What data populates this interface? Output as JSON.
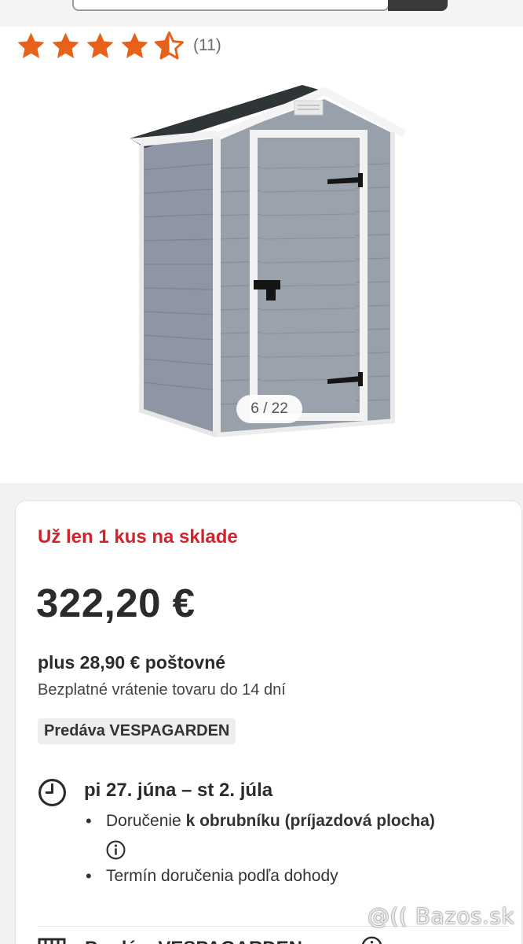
{
  "header": {
    "search": {
      "placeholder": ""
    }
  },
  "rating": {
    "value": 4.5,
    "max": 5,
    "count_label": "(11)",
    "star_color": "#e8611a"
  },
  "gallery": {
    "counter": "6 / 22",
    "image_alt": "shed-image"
  },
  "offer": {
    "stock": "Už len 1 kus na sklade",
    "price": "322,20 €",
    "shipping": "plus 28,90 € poštovné",
    "returns": "Bezplatné vrátenie tovaru do 14 dní",
    "seller": "Predáva VESPAGARDEN",
    "delivery": {
      "dates": "pi 27. júna – st 2. júla",
      "items": [
        {
          "prefix": "Doručenie ",
          "bold": "k obrubníku (príjazdová plocha)"
        },
        {
          "prefix": "Termín doručenia podľa dohody",
          "bold": ""
        }
      ]
    },
    "next_section": "Predá... VESPAGARDEN"
  },
  "colors": {
    "accent_red": "#d2232a",
    "text_dark": "#2b2b2b"
  },
  "watermark": "@(( Bazos.sk"
}
